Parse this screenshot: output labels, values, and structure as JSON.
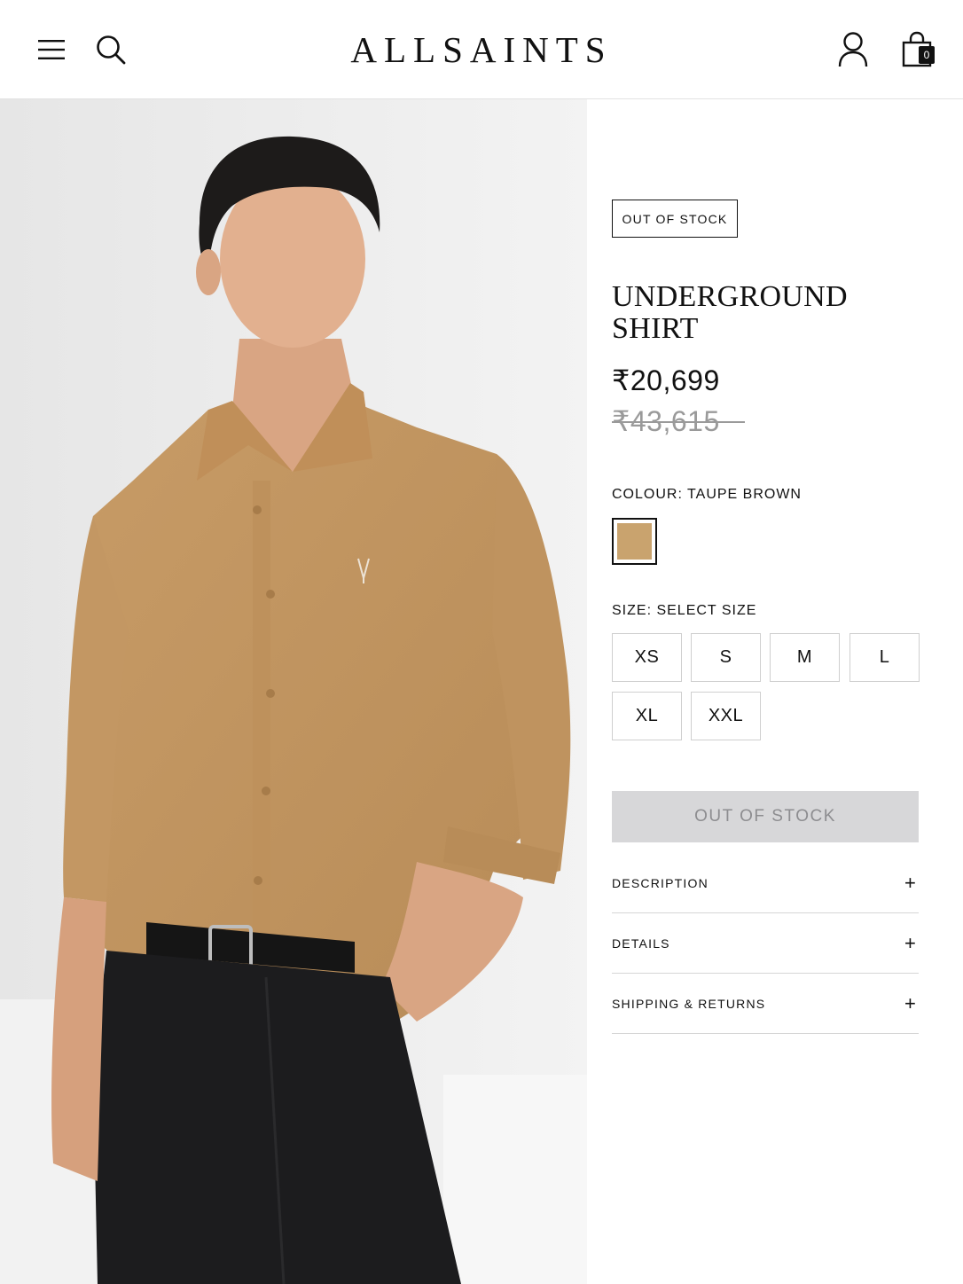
{
  "header": {
    "logo": "ALLSAINTS",
    "menu_icon": "hamburger-menu-icon",
    "search_icon": "search-icon",
    "account_icon": "user-account-icon",
    "bag_icon": "shopping-bag-icon",
    "bag_count": "0"
  },
  "product": {
    "image_description_icon": "product-photo",
    "stock_badge": "OUT OF STOCK",
    "title_line1": "UNDERGROUND",
    "title_line2": "SHIRT",
    "price": "₹20,699",
    "was_price": "₹43,615",
    "colour_label": "COLOUR: TAUPE BROWN",
    "colour_swatch": "#c9a36e",
    "size_label": "SIZE: SELECT SIZE",
    "sizes": [
      "XS",
      "S",
      "M",
      "L",
      "XL",
      "XXL"
    ],
    "add_button_label": "OUT OF STOCK",
    "add_button_bg": "#d7d7d9",
    "add_button_text_color": "#8d8d90",
    "accordions": [
      {
        "label": "DESCRIPTION",
        "icon": "+"
      },
      {
        "label": "DETAILS",
        "icon": "+"
      },
      {
        "label": "SHIPPING & RETURNS",
        "icon": "+"
      }
    ]
  }
}
